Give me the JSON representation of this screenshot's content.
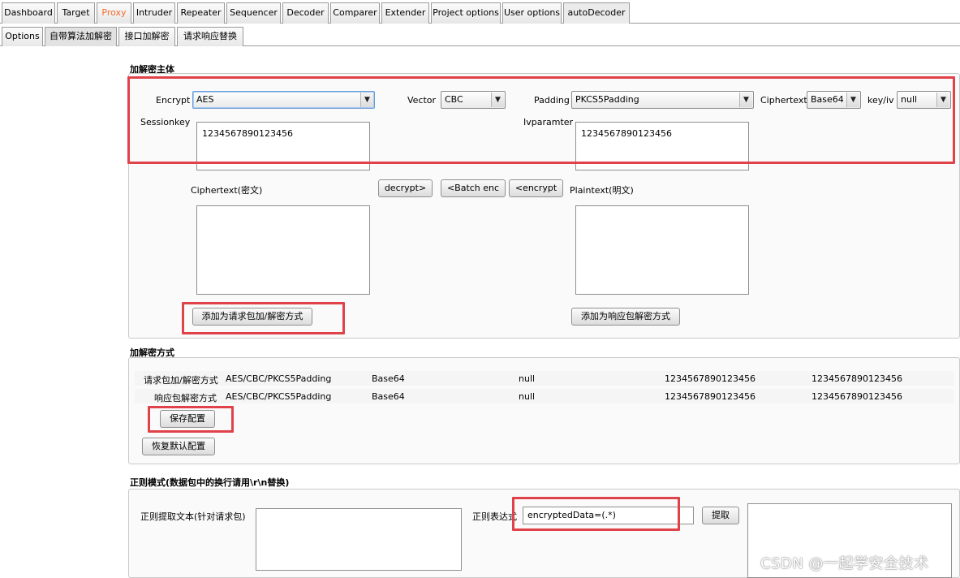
{
  "tabs": [
    "Dashboard",
    "Target",
    "Proxy",
    "Intruder",
    "Repeater",
    "Sequencer",
    "Decoder",
    "Comparer",
    "Extender",
    "Project options",
    "User options",
    "autoDecoder"
  ],
  "subtabs": [
    "Options",
    "自带算法加解密",
    "接口加解密",
    "请求响应替换"
  ],
  "section1": {
    "title": "加解密主体",
    "encrypt_label": "Encrypt",
    "encrypt_value": "AES",
    "vector_label": "Vector",
    "vector_value": "CBC",
    "padding_label": "Padding",
    "padding_value": "PKCS5Padding",
    "ciphertext_label": "Ciphertext",
    "ciphertext_value": "Base64",
    "keyiv_label": "key/iv",
    "keyiv_value": "null",
    "sessionkey_label": "Sessionkey",
    "sessionkey_value": "1234567890123456",
    "ivparam_label": "Ivparamter",
    "ivparam_value": "1234567890123456",
    "ciphertext_box_label": "Ciphertext(密文)",
    "plaintext_box_label": "Plaintext(明文)",
    "decrypt_button": "decrypt>",
    "batch_enc_button": "<Batch enc",
    "encrypt_button": "<encrypt",
    "add_request_button": "添加为请求包加/解密方式",
    "add_response_button": "添加为响应包解密方式"
  },
  "section2": {
    "title": "加解密方式",
    "rows": [
      {
        "label": "请求包加/解密方式",
        "algo": "AES/CBC/PKCS5Padding",
        "format": "Base64",
        "keyiv": "null",
        "key": "1234567890123456",
        "iv": "1234567890123456"
      },
      {
        "label": "响应包解密方式",
        "algo": "AES/CBC/PKCS5Padding",
        "format": "Base64",
        "keyiv": "null",
        "key": "1234567890123456",
        "iv": "1234567890123456"
      }
    ],
    "save_button": "保存配置",
    "restore_button": "恢复默认配置"
  },
  "section3": {
    "title": "正则模式(数据包中的换行请用\\r\\n替换)",
    "extract_label": "正则提取文本(针对请求包)",
    "regex_label": "正则表达式",
    "regex_value": "encryptedData=(.*)",
    "extract_button": "提取"
  },
  "watermark": "CSDN @一起学安全技术",
  "colors": {
    "highlight": "#e0424a",
    "proxy_tab": "#f26b2e"
  }
}
